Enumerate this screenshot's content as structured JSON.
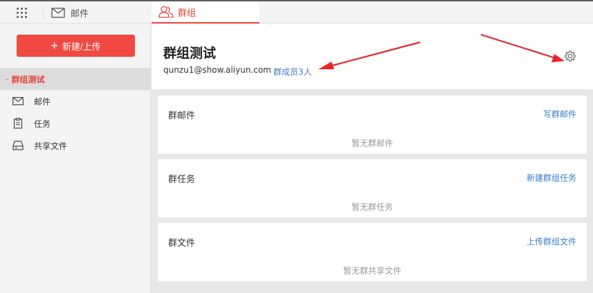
{
  "topbar": {
    "mail_tab_label": "邮件",
    "group_tab_label": "群组"
  },
  "sidebar": {
    "new_button_label": "新建/上传",
    "group_name": "群组测试",
    "items": [
      {
        "label": "邮件",
        "icon": "mail-icon"
      },
      {
        "label": "任务",
        "icon": "clipboard-icon"
      },
      {
        "label": "共享文件",
        "icon": "drive-icon"
      }
    ]
  },
  "header": {
    "title": "群组测试",
    "email": "qunzu1@show.aliyun.com",
    "members_link": "群成员3人"
  },
  "cards": [
    {
      "title": "群邮件",
      "action": "写群邮件",
      "empty": "暂无群邮件"
    },
    {
      "title": "群任务",
      "action": "新建群组任务",
      "empty": "暂无群任务"
    },
    {
      "title": "群文件",
      "action": "上传群组文件",
      "empty": "暂无群共享文件"
    }
  ],
  "colors": {
    "accent": "#e8433c",
    "link": "#3a7ec7",
    "annotation_arrow": "#e8262b"
  }
}
